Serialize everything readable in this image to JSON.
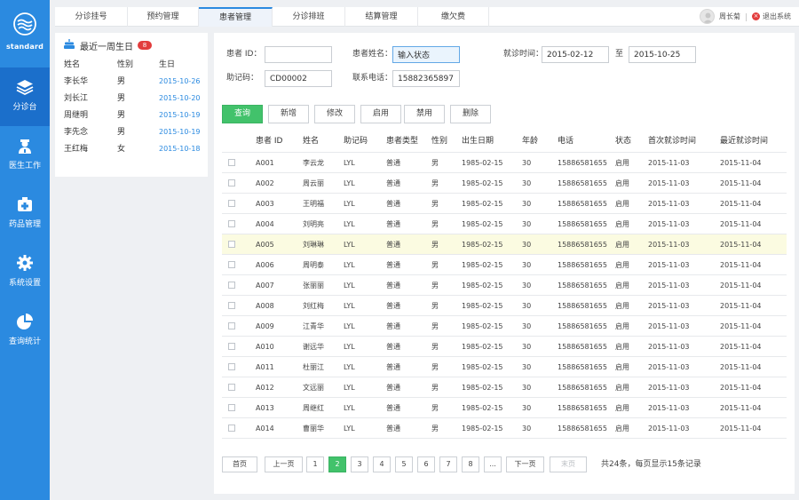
{
  "brand": {
    "name": "standard"
  },
  "nav": [
    {
      "label": "分诊台",
      "icon": "layers-icon"
    },
    {
      "label": "医生工作",
      "icon": "doctor-icon"
    },
    {
      "label": "药品管理",
      "icon": "medicine-box-icon"
    },
    {
      "label": "系统设置",
      "icon": "gear-icon"
    },
    {
      "label": "查询统计",
      "icon": "pie-chart-icon"
    }
  ],
  "tabs": [
    "分诊挂号",
    "预约管理",
    "患者管理",
    "分诊排班",
    "结算管理",
    "缴欠费"
  ],
  "user": {
    "name": "周长菊",
    "logout": "退出系统"
  },
  "birthday": {
    "title": "最近一周生日",
    "count": "8",
    "headers": [
      "姓名",
      "性别",
      "生日"
    ],
    "rows": [
      [
        "李长华",
        "男",
        "2015-10-26"
      ],
      [
        "刘长江",
        "男",
        "2015-10-20"
      ],
      [
        "周继明",
        "男",
        "2015-10-19"
      ],
      [
        "李先念",
        "男",
        "2015-10-19"
      ],
      [
        "王红梅",
        "女",
        "2015-10-18"
      ]
    ]
  },
  "form": {
    "patient_id_label": "患者 ID：",
    "patient_id_value": "",
    "patient_name_label": "患者姓名：",
    "patient_name_value": "输入状态",
    "visit_time_label": "就诊时间：",
    "visit_from": "2015-02-12",
    "to_label": "至",
    "visit_to": "2015-10-25",
    "mnemonic_label": "助记码：",
    "mnemonic_value": "CD00002",
    "phone_label": "联系电话：",
    "phone_value": "15882365897"
  },
  "actions": [
    "查询",
    "新增",
    "修改",
    "启用",
    "禁用",
    "删除"
  ],
  "table": {
    "headers": [
      "患者 ID",
      "姓名",
      "助记码",
      "患者类型",
      "性别",
      "出生日期",
      "年龄",
      "电话",
      "状态",
      "首次就诊时间",
      "最近就诊时间"
    ],
    "rows": [
      [
        "A001",
        "李云龙",
        "LYL",
        "普通",
        "男",
        "1985-02-15",
        "30",
        "15886581655",
        "启用",
        "2015-11-03",
        "2015-11-04"
      ],
      [
        "A002",
        "周云丽",
        "LYL",
        "普通",
        "男",
        "1985-02-15",
        "30",
        "15886581655",
        "启用",
        "2015-11-03",
        "2015-11-04"
      ],
      [
        "A003",
        "王明福",
        "LYL",
        "普通",
        "男",
        "1985-02-15",
        "30",
        "15886581655",
        "启用",
        "2015-11-03",
        "2015-11-04"
      ],
      [
        "A004",
        "刘明亮",
        "LYL",
        "普通",
        "男",
        "1985-02-15",
        "30",
        "15886581655",
        "启用",
        "2015-11-03",
        "2015-11-04"
      ],
      [
        "A005",
        "刘琳琳",
        "LYL",
        "普通",
        "男",
        "1985-02-15",
        "30",
        "15886581655",
        "启用",
        "2015-11-03",
        "2015-11-04"
      ],
      [
        "A006",
        "周明泰",
        "LYL",
        "普通",
        "男",
        "1985-02-15",
        "30",
        "15886581655",
        "启用",
        "2015-11-03",
        "2015-11-04"
      ],
      [
        "A007",
        "张丽丽",
        "LYL",
        "普通",
        "男",
        "1985-02-15",
        "30",
        "15886581655",
        "启用",
        "2015-11-03",
        "2015-11-04"
      ],
      [
        "A008",
        "刘红梅",
        "LYL",
        "普通",
        "男",
        "1985-02-15",
        "30",
        "15886581655",
        "启用",
        "2015-11-03",
        "2015-11-04"
      ],
      [
        "A009",
        "江青华",
        "LYL",
        "普通",
        "男",
        "1985-02-15",
        "30",
        "15886581655",
        "启用",
        "2015-11-03",
        "2015-11-04"
      ],
      [
        "A010",
        "谢远华",
        "LYL",
        "普通",
        "男",
        "1985-02-15",
        "30",
        "15886581655",
        "启用",
        "2015-11-03",
        "2015-11-04"
      ],
      [
        "A011",
        "杜丽江",
        "LYL",
        "普通",
        "男",
        "1985-02-15",
        "30",
        "15886581655",
        "启用",
        "2015-11-03",
        "2015-11-04"
      ],
      [
        "A012",
        "文远丽",
        "LYL",
        "普通",
        "男",
        "1985-02-15",
        "30",
        "15886581655",
        "启用",
        "2015-11-03",
        "2015-11-04"
      ],
      [
        "A013",
        "周继红",
        "LYL",
        "普通",
        "男",
        "1985-02-15",
        "30",
        "15886581655",
        "启用",
        "2015-11-03",
        "2015-11-04"
      ],
      [
        "A014",
        "曹丽华",
        "LYL",
        "普通",
        "男",
        "1985-02-15",
        "30",
        "15886581655",
        "启用",
        "2015-11-03",
        "2015-11-04"
      ]
    ]
  },
  "pager": {
    "first": "首页",
    "prev": "上一页",
    "pages": [
      "1",
      "2",
      "3",
      "4",
      "5",
      "6",
      "7",
      "8",
      "..."
    ],
    "next": "下一页",
    "last": "末页",
    "info": "共24条，每页显示15条记录"
  },
  "colors": {
    "nav": "#2b8ae0",
    "nav_active": "#1b6fcb",
    "primary": "#42c26b",
    "link": "#2b8ae0",
    "badge": "#e23c3c",
    "highlight_row": "#fbfbe1"
  }
}
